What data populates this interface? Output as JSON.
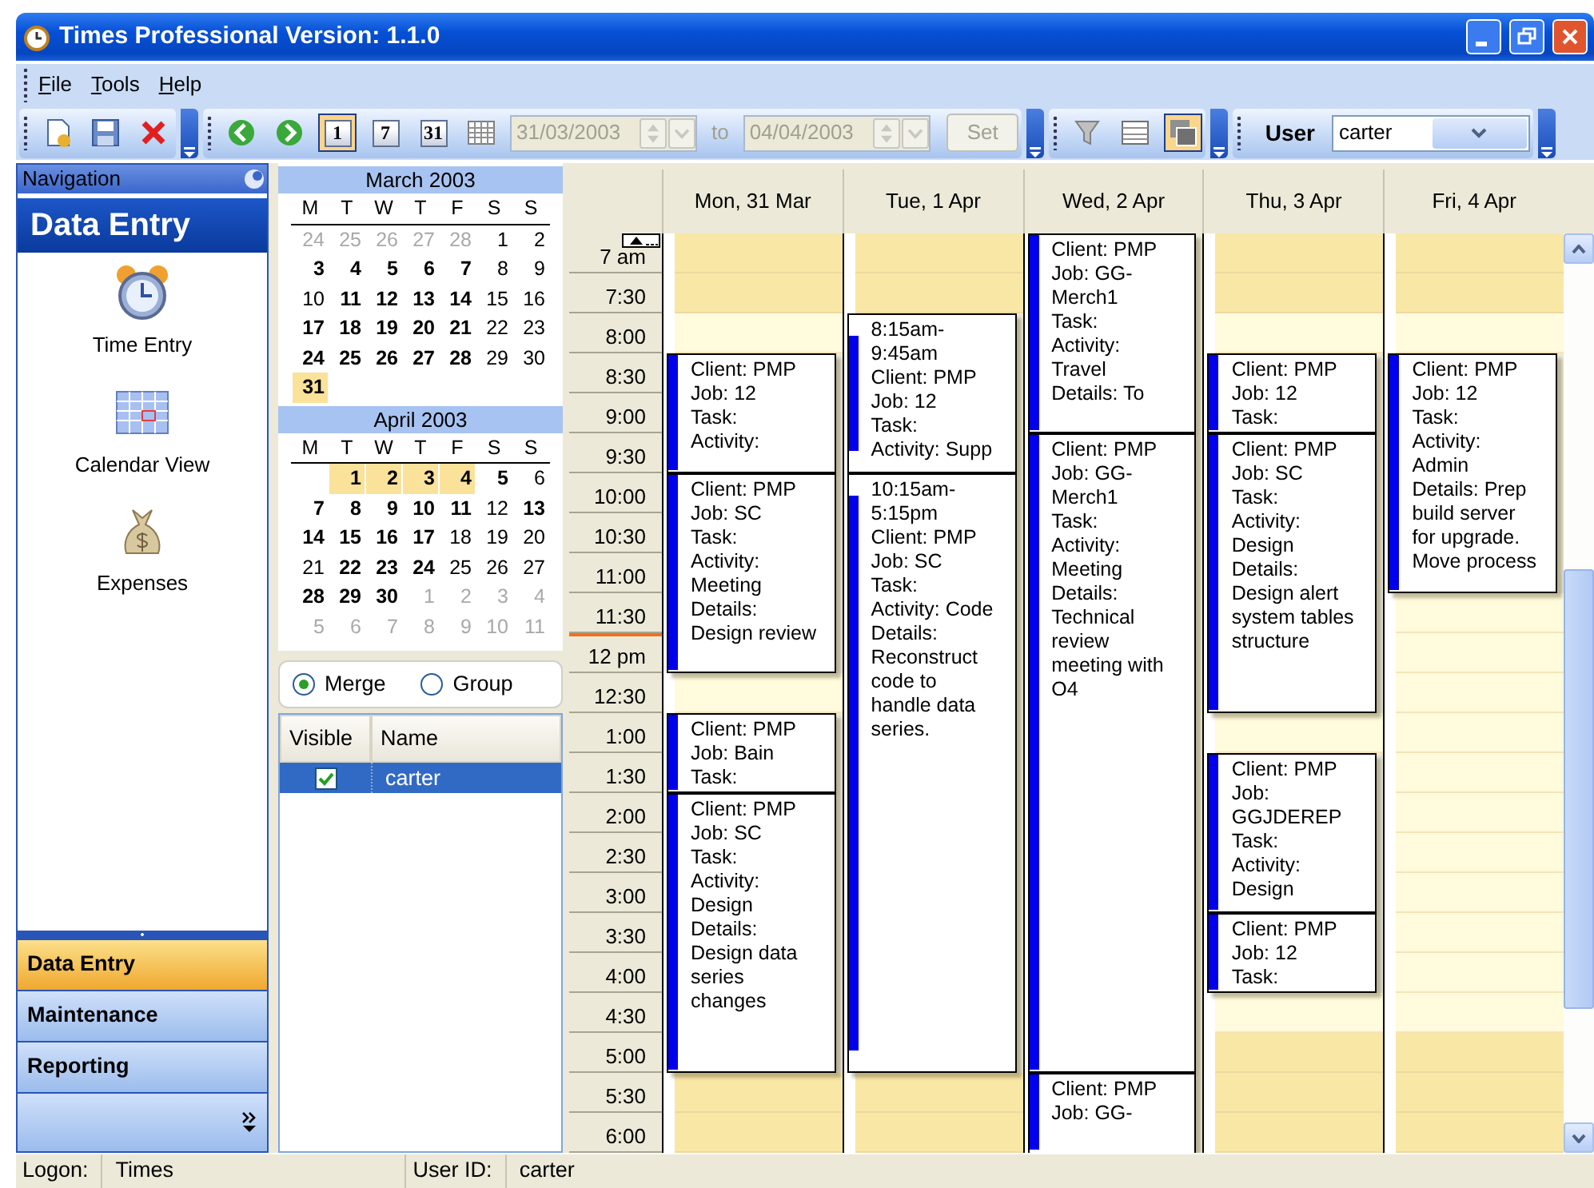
{
  "window": {
    "title": "Times Professional Version: 1.1.0"
  },
  "menu": [
    {
      "label": "File",
      "underline_first": true
    },
    {
      "label": "Tools",
      "underline_first": true
    },
    {
      "label": "Help",
      "underline_first": true
    }
  ],
  "toolbar": {
    "file_buttons": [
      {
        "kind": "new"
      },
      {
        "kind": "save"
      },
      {
        "kind": "delete"
      }
    ],
    "nav_buttons": [
      {
        "kind": "back"
      },
      {
        "kind": "forward"
      }
    ],
    "view_buttons": [
      {
        "kind": "day",
        "label": "1",
        "selected": true
      },
      {
        "kind": "week",
        "label": "7",
        "selected": false
      },
      {
        "kind": "month",
        "label": "31",
        "selected": false
      },
      {
        "kind": "grid",
        "selected": false
      }
    ],
    "date_range": {
      "from": "31/03/2003",
      "separator": "to",
      "to": "04/04/2003",
      "set_button": "Set",
      "disabled": true
    },
    "display_buttons": [
      {
        "kind": "filter",
        "selected": false
      },
      {
        "kind": "table",
        "selected": false
      },
      {
        "kind": "panes",
        "selected": true
      }
    ],
    "user_filter": {
      "label": "User",
      "value": "carter"
    }
  },
  "navigation": {
    "header": "Navigation",
    "section_title": "Data Entry",
    "items": [
      {
        "label": "Time Entry",
        "kind": "clock"
      },
      {
        "label": "Calendar View",
        "kind": "calendar"
      },
      {
        "label": "Expenses",
        "kind": "moneybag"
      }
    ],
    "sections": [
      {
        "label": "Data Entry",
        "selected": true
      },
      {
        "label": "Maintenance",
        "selected": false
      },
      {
        "label": "Reporting",
        "selected": false
      }
    ]
  },
  "mini_calendars": [
    {
      "title": "March 2003",
      "weekdays": [
        "M",
        "T",
        "W",
        "T",
        "F",
        "S",
        "S"
      ],
      "weeks": [
        [
          {
            "text": "24",
            "kind": "muted",
            "selected": false
          },
          {
            "text": "25",
            "kind": "muted",
            "selected": false
          },
          {
            "text": "26",
            "kind": "muted",
            "selected": false
          },
          {
            "text": "27",
            "kind": "muted",
            "selected": false
          },
          {
            "text": "28",
            "kind": "muted",
            "selected": false
          },
          {
            "text": "1",
            "kind": "plain",
            "selected": false
          },
          {
            "text": "2",
            "kind": "plain",
            "selected": false
          }
        ],
        [
          {
            "text": "3",
            "kind": "bold",
            "selected": false
          },
          {
            "text": "4",
            "kind": "bold",
            "selected": false
          },
          {
            "text": "5",
            "kind": "bold",
            "selected": false
          },
          {
            "text": "6",
            "kind": "bold",
            "selected": false
          },
          {
            "text": "7",
            "kind": "bold",
            "selected": false
          },
          {
            "text": "8",
            "kind": "plain",
            "selected": false
          },
          {
            "text": "9",
            "kind": "plain",
            "selected": false
          }
        ],
        [
          {
            "text": "10",
            "kind": "plain",
            "selected": false
          },
          {
            "text": "11",
            "kind": "bold",
            "selected": false
          },
          {
            "text": "12",
            "kind": "bold",
            "selected": false
          },
          {
            "text": "13",
            "kind": "bold",
            "selected": false
          },
          {
            "text": "14",
            "kind": "bold",
            "selected": false
          },
          {
            "text": "15",
            "kind": "plain",
            "selected": false
          },
          {
            "text": "16",
            "kind": "plain",
            "selected": false
          }
        ],
        [
          {
            "text": "17",
            "kind": "bold",
            "selected": false
          },
          {
            "text": "18",
            "kind": "bold",
            "selected": false
          },
          {
            "text": "19",
            "kind": "bold",
            "selected": false
          },
          {
            "text": "20",
            "kind": "bold",
            "selected": false
          },
          {
            "text": "21",
            "kind": "bold",
            "selected": false
          },
          {
            "text": "22",
            "kind": "plain",
            "selected": false
          },
          {
            "text": "23",
            "kind": "plain",
            "selected": false
          }
        ],
        [
          {
            "text": "24",
            "kind": "bold",
            "selected": false
          },
          {
            "text": "25",
            "kind": "bold",
            "selected": false
          },
          {
            "text": "26",
            "kind": "bold",
            "selected": false
          },
          {
            "text": "27",
            "kind": "bold",
            "selected": false
          },
          {
            "text": "28",
            "kind": "bold",
            "selected": false
          },
          {
            "text": "29",
            "kind": "plain",
            "selected": false
          },
          {
            "text": "30",
            "kind": "plain",
            "selected": false
          }
        ],
        [
          {
            "text": "31",
            "kind": "bold",
            "selected": true
          }
        ]
      ]
    },
    {
      "title": "April 2003",
      "weekdays": [
        "M",
        "T",
        "W",
        "T",
        "F",
        "S",
        "S"
      ],
      "weeks": [
        [
          {
            "text": "1",
            "kind": "bold",
            "selected": true
          },
          {
            "text": "2",
            "kind": "bold",
            "selected": true
          },
          {
            "text": "3",
            "kind": "bold",
            "selected": true
          },
          {
            "text": "4",
            "kind": "bold",
            "selected": true
          },
          {
            "text": "5",
            "kind": "bold",
            "selected": false
          },
          {
            "text": "6",
            "kind": "plain",
            "selected": false
          }
        ],
        [
          {
            "text": "7",
            "kind": "bold",
            "selected": false
          },
          {
            "text": "8",
            "kind": "bold",
            "selected": false
          },
          {
            "text": "9",
            "kind": "bold",
            "selected": false
          },
          {
            "text": "10",
            "kind": "bold",
            "selected": false
          },
          {
            "text": "11",
            "kind": "bold",
            "selected": false
          },
          {
            "text": "12",
            "kind": "plain",
            "selected": false
          },
          {
            "text": "13",
            "kind": "bold",
            "selected": false
          }
        ],
        [
          {
            "text": "14",
            "kind": "bold",
            "selected": false
          },
          {
            "text": "15",
            "kind": "bold",
            "selected": false
          },
          {
            "text": "16",
            "kind": "bold",
            "selected": false
          },
          {
            "text": "17",
            "kind": "bold",
            "selected": false
          },
          {
            "text": "18",
            "kind": "plain",
            "selected": false
          },
          {
            "text": "19",
            "kind": "plain",
            "selected": false
          },
          {
            "text": "20",
            "kind": "plain",
            "selected": false
          }
        ],
        [
          {
            "text": "21",
            "kind": "plain",
            "selected": false
          },
          {
            "text": "22",
            "kind": "bold",
            "selected": false
          },
          {
            "text": "23",
            "kind": "bold",
            "selected": false
          },
          {
            "text": "24",
            "kind": "bold",
            "selected": false
          },
          {
            "text": "25",
            "kind": "plain",
            "selected": false
          },
          {
            "text": "26",
            "kind": "plain",
            "selected": false
          },
          {
            "text": "27",
            "kind": "plain",
            "selected": false
          }
        ],
        [
          {
            "text": "28",
            "kind": "bold",
            "selected": false
          },
          {
            "text": "29",
            "kind": "bold",
            "selected": false
          },
          {
            "text": "30",
            "kind": "bold",
            "selected": false
          },
          {
            "text": "1",
            "kind": "muted",
            "selected": false
          },
          {
            "text": "2",
            "kind": "muted",
            "selected": false
          },
          {
            "text": "3",
            "kind": "muted",
            "selected": false
          },
          {
            "text": "4",
            "kind": "muted",
            "selected": false
          }
        ],
        [
          {
            "text": "5",
            "kind": "muted",
            "selected": false
          },
          {
            "text": "6",
            "kind": "muted",
            "selected": false
          },
          {
            "text": "7",
            "kind": "muted",
            "selected": false
          },
          {
            "text": "8",
            "kind": "muted",
            "selected": false
          },
          {
            "text": "9",
            "kind": "muted",
            "selected": false
          },
          {
            "text": "10",
            "kind": "muted",
            "selected": false
          },
          {
            "text": "11",
            "kind": "muted",
            "selected": false
          }
        ]
      ]
    }
  ],
  "view_mode": [
    {
      "label": "Merge",
      "selected": true
    },
    {
      "label": "Group",
      "selected": false
    }
  ],
  "users_grid": {
    "columns": [
      "Visible",
      "Name"
    ],
    "rows": [
      {
        "visible": true,
        "name": "carter",
        "selected": true
      }
    ]
  },
  "schedule": {
    "times": [
      {
        "label": "7 am",
        "work": false,
        "current": false
      },
      {
        "label": "7:30",
        "work": false,
        "current": false
      },
      {
        "label": "8:00",
        "work": true,
        "current": false
      },
      {
        "label": "8:30",
        "current": false
      },
      {
        "label": "9:00",
        "current": false
      },
      {
        "label": "9:30",
        "current": false
      },
      {
        "label": "10:00",
        "current": false
      },
      {
        "label": "10:30",
        "current": false
      },
      {
        "label": "11:00",
        "current": false
      },
      {
        "label": "11:30",
        "work": true,
        "current": false
      },
      {
        "label": "12 pm",
        "work": true,
        "current": true
      },
      {
        "label": "12:30",
        "work": true,
        "current": false
      },
      {
        "label": "1:00",
        "work": true,
        "current": false
      },
      {
        "label": "1:30",
        "work": true,
        "current": false
      },
      {
        "label": "2:00",
        "work": true,
        "current": false
      },
      {
        "label": "2:30",
        "work": true,
        "current": false
      },
      {
        "label": "3:00",
        "work": true,
        "current": false
      },
      {
        "label": "3:30",
        "work": true,
        "current": false
      },
      {
        "label": "4:00",
        "work": true,
        "current": false
      },
      {
        "label": "4:30",
        "work": true,
        "current": false
      },
      {
        "label": "5:00",
        "work": false,
        "current": false
      },
      {
        "label": "5:30",
        "work": false,
        "current": false
      },
      {
        "label": "6:00",
        "work": false,
        "current": false
      }
    ],
    "days": [
      {
        "label": "Mon, 31 Mar",
        "slots": [
          {
            "kind": "free"
          },
          {
            "kind": "free"
          },
          {
            "kind": "free"
          },
          {
            "kind": "event",
            "lines": [
              "Client: PMP",
              "Job: 12",
              "Task:",
              "Activity:"
            ]
          },
          {
            "kind": "busy"
          },
          {
            "kind": "busy"
          },
          {
            "kind": "event",
            "lines": [
              "Client: PMP",
              "Job: SC",
              "Task:",
              "Activity:",
              "Meeting",
              "Details:",
              "Design review"
            ]
          },
          {
            "kind": "busy"
          },
          {
            "kind": "busy"
          },
          {
            "kind": "busy"
          },
          {
            "kind": "busy"
          },
          {
            "kind": "free"
          },
          {
            "kind": "event",
            "lines": [
              "Client: PMP",
              "Job: Bain",
              "Task:"
            ]
          },
          {
            "kind": "busy"
          },
          {
            "kind": "event",
            "lines": [
              "Client: PMP",
              "Job: SC",
              "Task:",
              "Activity:",
              "Design",
              "Details:",
              "Design data",
              "series",
              "changes"
            ]
          },
          {
            "kind": "busy"
          },
          {
            "kind": "busy"
          },
          {
            "kind": "busy"
          },
          {
            "kind": "busy"
          },
          {
            "kind": "busy"
          },
          {
            "kind": "busy"
          },
          {
            "kind": "free"
          },
          {
            "kind": "free"
          }
        ]
      },
      {
        "label": "Tue, 1 Apr",
        "slots": [
          {
            "kind": "free"
          },
          {
            "kind": "free"
          },
          {
            "kind": "event",
            "partial_start": true,
            "partial_end": true,
            "lines": [
              "8:15am-",
              "9:45am",
              "Client: PMP",
              "Job: 12",
              "Task:",
              "Activity: Supp"
            ]
          },
          {
            "kind": "busy"
          },
          {
            "kind": "busy"
          },
          {
            "kind": "busy"
          },
          {
            "kind": "event",
            "partial_start": true,
            "partial_end": true,
            "lines": [
              "10:15am-",
              "5:15pm",
              "Client: PMP",
              "Job: SC",
              "Task:",
              "Activity: Code",
              "Details:",
              "Reconstruct",
              "code to",
              "handle data",
              "series."
            ]
          },
          {
            "kind": "busy"
          },
          {
            "kind": "busy"
          },
          {
            "kind": "busy"
          },
          {
            "kind": "busy"
          },
          {
            "kind": "busy"
          },
          {
            "kind": "busy"
          },
          {
            "kind": "busy"
          },
          {
            "kind": "busy"
          },
          {
            "kind": "busy"
          },
          {
            "kind": "busy"
          },
          {
            "kind": "busy"
          },
          {
            "kind": "busy"
          },
          {
            "kind": "busy"
          },
          {
            "kind": "busy"
          },
          {
            "kind": "free"
          },
          {
            "kind": "free"
          }
        ]
      },
      {
        "label": "Wed, 2 Apr",
        "slots": [
          {
            "kind": "event",
            "lines": [
              "Client: PMP",
              "Job: GG-",
              "Merch1",
              "Task:",
              "Activity:",
              "Travel",
              "Details: To"
            ]
          },
          {
            "kind": "busy"
          },
          {
            "kind": "busy"
          },
          {
            "kind": "busy"
          },
          {
            "kind": "busy"
          },
          {
            "kind": "event",
            "lines": [
              "Client: PMP",
              "Job: GG-",
              "Merch1",
              "Task:",
              "Activity:",
              "Meeting",
              "Details:",
              "Technical",
              "review",
              "meeting with",
              "O4"
            ]
          },
          {
            "kind": "busy"
          },
          {
            "kind": "busy"
          },
          {
            "kind": "busy"
          },
          {
            "kind": "busy"
          },
          {
            "kind": "busy"
          },
          {
            "kind": "busy"
          },
          {
            "kind": "busy"
          },
          {
            "kind": "busy"
          },
          {
            "kind": "busy"
          },
          {
            "kind": "busy"
          },
          {
            "kind": "busy"
          },
          {
            "kind": "busy"
          },
          {
            "kind": "busy"
          },
          {
            "kind": "busy"
          },
          {
            "kind": "busy"
          },
          {
            "kind": "event",
            "lines": [
              "Client: PMP",
              "Job: GG-"
            ]
          },
          {
            "kind": "busy"
          }
        ]
      },
      {
        "label": "Thu, 3 Apr",
        "slots": [
          {
            "kind": "free"
          },
          {
            "kind": "free"
          },
          {
            "kind": "free"
          },
          {
            "kind": "event",
            "lines": [
              "Client: PMP",
              "Job: 12",
              "Task:"
            ]
          },
          {
            "kind": "busy"
          },
          {
            "kind": "event",
            "lines": [
              "Client: PMP",
              "Job: SC",
              "Task:",
              "Activity:",
              "Design",
              "Details:",
              "Design alert",
              "system tables",
              "structure"
            ]
          },
          {
            "kind": "busy"
          },
          {
            "kind": "busy"
          },
          {
            "kind": "busy"
          },
          {
            "kind": "busy"
          },
          {
            "kind": "busy"
          },
          {
            "kind": "busy"
          },
          {
            "kind": "free"
          },
          {
            "kind": "event",
            "lines": [
              "Client: PMP",
              "Job:",
              "GGJDEREP",
              "Task:",
              "Activity:",
              "Design"
            ]
          },
          {
            "kind": "busy"
          },
          {
            "kind": "busy"
          },
          {
            "kind": "busy"
          },
          {
            "kind": "event",
            "lines": [
              "Client: PMP",
              "Job: 12",
              "Task:"
            ]
          },
          {
            "kind": "busy"
          },
          {
            "kind": "free"
          },
          {
            "kind": "free"
          },
          {
            "kind": "free"
          },
          {
            "kind": "free"
          }
        ]
      },
      {
        "label": "Fri, 4 Apr",
        "slots": [
          {
            "kind": "free"
          },
          {
            "kind": "free"
          },
          {
            "kind": "free"
          },
          {
            "kind": "event",
            "lines": [
              "Client: PMP",
              "Job: 12",
              "Task:",
              "Activity:",
              "Admin",
              "Details: Prep",
              "build server",
              "for upgrade.",
              "Move process"
            ]
          },
          {
            "kind": "busy"
          },
          {
            "kind": "busy"
          },
          {
            "kind": "busy"
          },
          {
            "kind": "busy"
          },
          {
            "kind": "busy"
          },
          {
            "kind": "free"
          },
          {
            "kind": "free"
          },
          {
            "kind": "free"
          },
          {
            "kind": "free"
          },
          {
            "kind": "free"
          },
          {
            "kind": "free"
          },
          {
            "kind": "free"
          },
          {
            "kind": "free"
          },
          {
            "kind": "free"
          },
          {
            "kind": "free"
          },
          {
            "kind": "free"
          },
          {
            "kind": "free"
          },
          {
            "kind": "free"
          },
          {
            "kind": "free"
          }
        ]
      }
    ]
  },
  "status_bar": [
    {
      "label": "Logon:",
      "value": "Times"
    },
    {
      "label": "User ID:",
      "value": "carter"
    }
  ]
}
